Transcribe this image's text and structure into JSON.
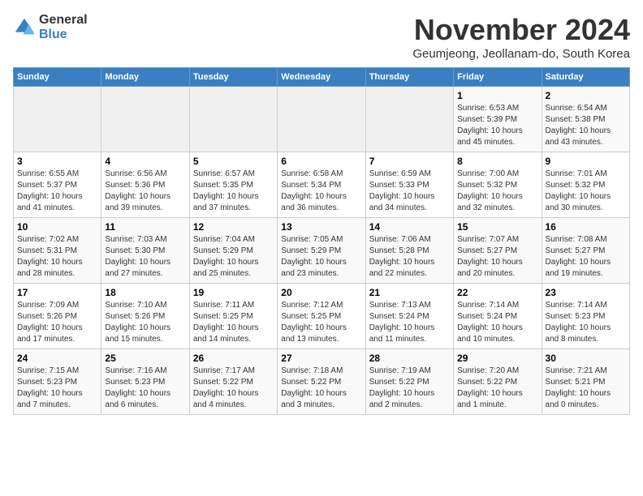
{
  "logo": {
    "general": "General",
    "blue": "Blue"
  },
  "header": {
    "month": "November 2024",
    "location": "Geumjeong, Jeollanam-do, South Korea"
  },
  "weekdays": [
    "Sunday",
    "Monday",
    "Tuesday",
    "Wednesday",
    "Thursday",
    "Friday",
    "Saturday"
  ],
  "weeks": [
    [
      {
        "day": "",
        "info": ""
      },
      {
        "day": "",
        "info": ""
      },
      {
        "day": "",
        "info": ""
      },
      {
        "day": "",
        "info": ""
      },
      {
        "day": "",
        "info": ""
      },
      {
        "day": "1",
        "info": "Sunrise: 6:53 AM\nSunset: 5:39 PM\nDaylight: 10 hours and 45 minutes."
      },
      {
        "day": "2",
        "info": "Sunrise: 6:54 AM\nSunset: 5:38 PM\nDaylight: 10 hours and 43 minutes."
      }
    ],
    [
      {
        "day": "3",
        "info": "Sunrise: 6:55 AM\nSunset: 5:37 PM\nDaylight: 10 hours and 41 minutes."
      },
      {
        "day": "4",
        "info": "Sunrise: 6:56 AM\nSunset: 5:36 PM\nDaylight: 10 hours and 39 minutes."
      },
      {
        "day": "5",
        "info": "Sunrise: 6:57 AM\nSunset: 5:35 PM\nDaylight: 10 hours and 37 minutes."
      },
      {
        "day": "6",
        "info": "Sunrise: 6:58 AM\nSunset: 5:34 PM\nDaylight: 10 hours and 36 minutes."
      },
      {
        "day": "7",
        "info": "Sunrise: 6:59 AM\nSunset: 5:33 PM\nDaylight: 10 hours and 34 minutes."
      },
      {
        "day": "8",
        "info": "Sunrise: 7:00 AM\nSunset: 5:32 PM\nDaylight: 10 hours and 32 minutes."
      },
      {
        "day": "9",
        "info": "Sunrise: 7:01 AM\nSunset: 5:32 PM\nDaylight: 10 hours and 30 minutes."
      }
    ],
    [
      {
        "day": "10",
        "info": "Sunrise: 7:02 AM\nSunset: 5:31 PM\nDaylight: 10 hours and 28 minutes."
      },
      {
        "day": "11",
        "info": "Sunrise: 7:03 AM\nSunset: 5:30 PM\nDaylight: 10 hours and 27 minutes."
      },
      {
        "day": "12",
        "info": "Sunrise: 7:04 AM\nSunset: 5:29 PM\nDaylight: 10 hours and 25 minutes."
      },
      {
        "day": "13",
        "info": "Sunrise: 7:05 AM\nSunset: 5:29 PM\nDaylight: 10 hours and 23 minutes."
      },
      {
        "day": "14",
        "info": "Sunrise: 7:06 AM\nSunset: 5:28 PM\nDaylight: 10 hours and 22 minutes."
      },
      {
        "day": "15",
        "info": "Sunrise: 7:07 AM\nSunset: 5:27 PM\nDaylight: 10 hours and 20 minutes."
      },
      {
        "day": "16",
        "info": "Sunrise: 7:08 AM\nSunset: 5:27 PM\nDaylight: 10 hours and 19 minutes."
      }
    ],
    [
      {
        "day": "17",
        "info": "Sunrise: 7:09 AM\nSunset: 5:26 PM\nDaylight: 10 hours and 17 minutes."
      },
      {
        "day": "18",
        "info": "Sunrise: 7:10 AM\nSunset: 5:26 PM\nDaylight: 10 hours and 15 minutes."
      },
      {
        "day": "19",
        "info": "Sunrise: 7:11 AM\nSunset: 5:25 PM\nDaylight: 10 hours and 14 minutes."
      },
      {
        "day": "20",
        "info": "Sunrise: 7:12 AM\nSunset: 5:25 PM\nDaylight: 10 hours and 13 minutes."
      },
      {
        "day": "21",
        "info": "Sunrise: 7:13 AM\nSunset: 5:24 PM\nDaylight: 10 hours and 11 minutes."
      },
      {
        "day": "22",
        "info": "Sunrise: 7:14 AM\nSunset: 5:24 PM\nDaylight: 10 hours and 10 minutes."
      },
      {
        "day": "23",
        "info": "Sunrise: 7:14 AM\nSunset: 5:23 PM\nDaylight: 10 hours and 8 minutes."
      }
    ],
    [
      {
        "day": "24",
        "info": "Sunrise: 7:15 AM\nSunset: 5:23 PM\nDaylight: 10 hours and 7 minutes."
      },
      {
        "day": "25",
        "info": "Sunrise: 7:16 AM\nSunset: 5:23 PM\nDaylight: 10 hours and 6 minutes."
      },
      {
        "day": "26",
        "info": "Sunrise: 7:17 AM\nSunset: 5:22 PM\nDaylight: 10 hours and 4 minutes."
      },
      {
        "day": "27",
        "info": "Sunrise: 7:18 AM\nSunset: 5:22 PM\nDaylight: 10 hours and 3 minutes."
      },
      {
        "day": "28",
        "info": "Sunrise: 7:19 AM\nSunset: 5:22 PM\nDaylight: 10 hours and 2 minutes."
      },
      {
        "day": "29",
        "info": "Sunrise: 7:20 AM\nSunset: 5:22 PM\nDaylight: 10 hours and 1 minute."
      },
      {
        "day": "30",
        "info": "Sunrise: 7:21 AM\nSunset: 5:21 PM\nDaylight: 10 hours and 0 minutes."
      }
    ]
  ]
}
